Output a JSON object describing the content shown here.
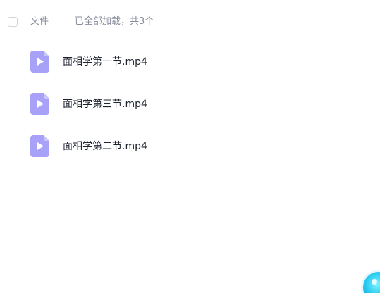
{
  "header": {
    "column_label": "文件",
    "load_status": "已全部加载，共3个"
  },
  "files": [
    {
      "name": "面相学第一节.mp4",
      "icon": "video-file-icon"
    },
    {
      "name": "面相学第三节.mp4",
      "icon": "video-file-icon"
    },
    {
      "name": "面相学第二节.mp4",
      "icon": "video-file-icon"
    }
  ],
  "colors": {
    "icon_bg": "#a7a2f7",
    "icon_fold": "#c9c6fb",
    "icon_play": "#ffffff",
    "floating_ball": "#27c9ee"
  }
}
